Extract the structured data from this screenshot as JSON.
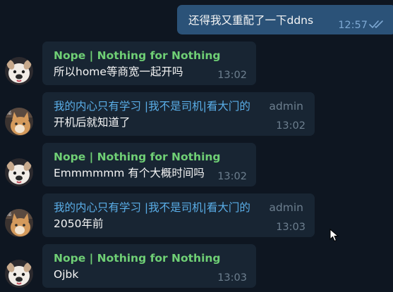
{
  "messages": [
    {
      "direction": "outgoing",
      "text": "还得我又重配了一下ddns",
      "time": "12:57",
      "read_status_icon": "double-check-icon"
    },
    {
      "direction": "incoming",
      "sender": "Nope | Nothing for Nothing",
      "sender_color": "#6fcf75",
      "avatar_icon": "bulldog-avatar-icon",
      "text": "所以home等商宽一起开吗",
      "time": "13:02"
    },
    {
      "direction": "incoming",
      "sender": "我的内心只有学习 |我不是司机|看大门的",
      "role": "admin",
      "sender_color": "#5aaee8",
      "avatar_icon": "cat-avatar-icon",
      "text": "开机后就知道了",
      "time": "13:02"
    },
    {
      "direction": "incoming",
      "sender": "Nope | Nothing for Nothing",
      "sender_color": "#6fcf75",
      "avatar_icon": "bulldog-avatar-icon",
      "text": "Emmmmmm 有个大概时间吗",
      "time": "13:02"
    },
    {
      "direction": "incoming",
      "sender": "我的内心只有学习 |我不是司机|看大门的",
      "role": "admin",
      "sender_color": "#5aaee8",
      "avatar_icon": "cat-avatar-icon",
      "text": "2050年前",
      "time": "13:03"
    },
    {
      "direction": "incoming",
      "sender": "Nope | Nothing for Nothing",
      "sender_color": "#6fcf75",
      "avatar_icon": "bulldog-avatar-icon",
      "text": "Ojbk",
      "time": "13:03"
    }
  ],
  "colors": {
    "background": "#0e1621",
    "incoming_bubble": "#182533",
    "outgoing_bubble": "#2b5278"
  }
}
